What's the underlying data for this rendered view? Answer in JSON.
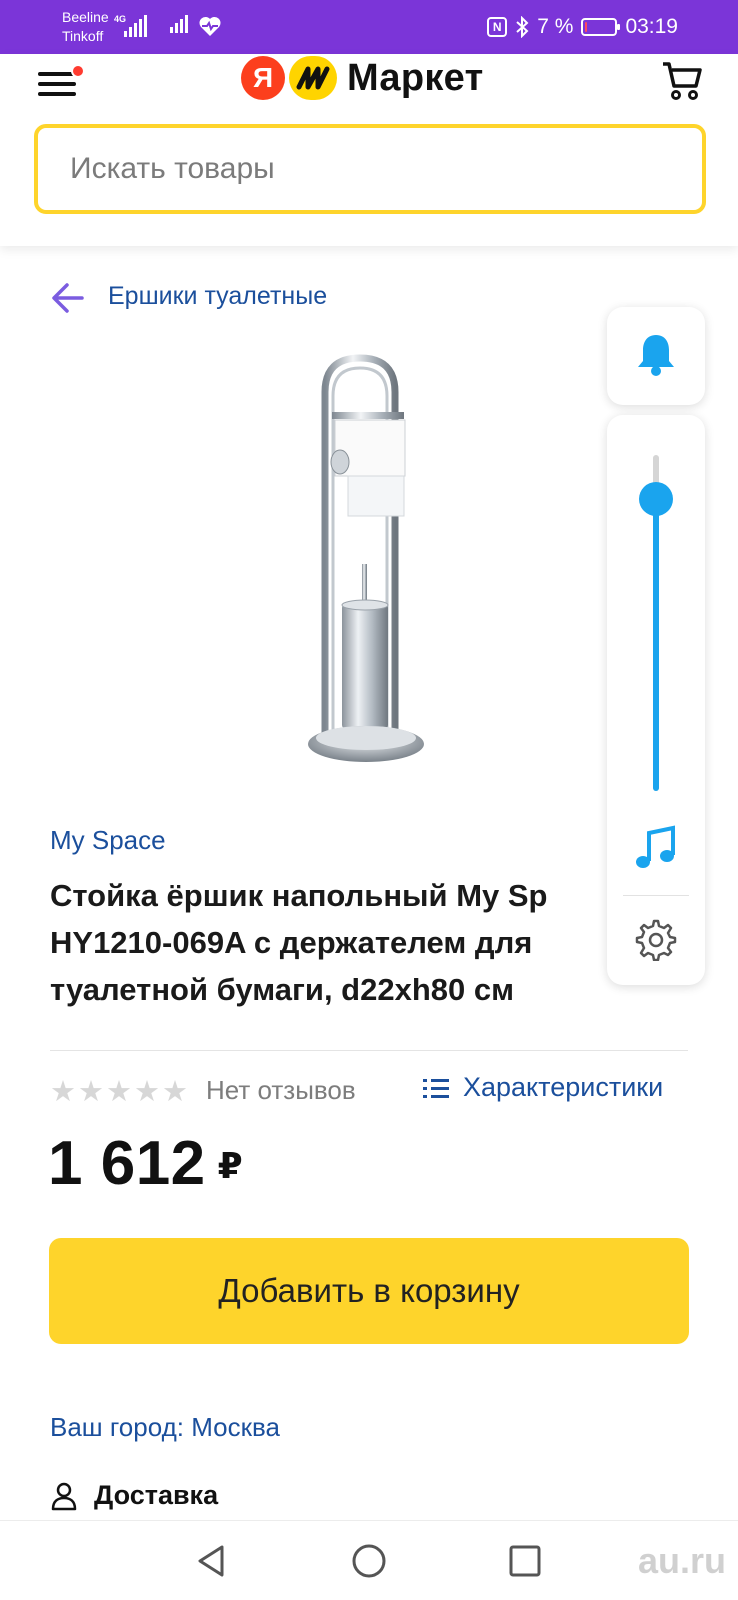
{
  "status_bar": {
    "carrier_1": "Beeline",
    "carrier_2": "Tinkoff",
    "network_badge": "4G",
    "battery_percent": "7 %",
    "battery_level": 0.07,
    "time": "03:19",
    "background_color": "#7b35d8",
    "icons": [
      "signal-icon",
      "heart-rate-icon",
      "nfc-icon",
      "bluetooth-icon",
      "battery-icon"
    ]
  },
  "header": {
    "logo_letter": "Я",
    "logo_text": "Маркет",
    "search_placeholder": "Искать товары",
    "search_value": "",
    "has_menu_notification": true,
    "accent_color": "#fed42b",
    "icons": [
      "menu-icon",
      "cart-icon"
    ]
  },
  "breadcrumb": {
    "label": "Ершики туалетные"
  },
  "product": {
    "brand": "My Space",
    "title_lines": [
      "Стойка ёршик напольный My Sp",
      "HY1210-069A с держателем для",
      "туалетной бумаги, d22xh80 см"
    ],
    "rating_stars": 0,
    "stars_total": 5,
    "reviews_label": "Нет отзывов",
    "specs_label": "Характеристики",
    "price": "1 612",
    "currency": "₽",
    "add_to_cart_label": "Добавить в корзину",
    "link_color": "#1b4f9c"
  },
  "city": {
    "label": "Ваш город: Москва"
  },
  "delivery": {
    "label": "Доставка"
  },
  "volume_panel": {
    "level": 0.87,
    "color": "#1aa4ee",
    "icons": [
      "bell-icon",
      "music-note-icon",
      "settings-gear-icon"
    ]
  },
  "nav_bar": {
    "icons": [
      "back-triangle-icon",
      "home-circle-icon",
      "recents-square-icon"
    ]
  },
  "watermark": {
    "text": "au.ru"
  }
}
